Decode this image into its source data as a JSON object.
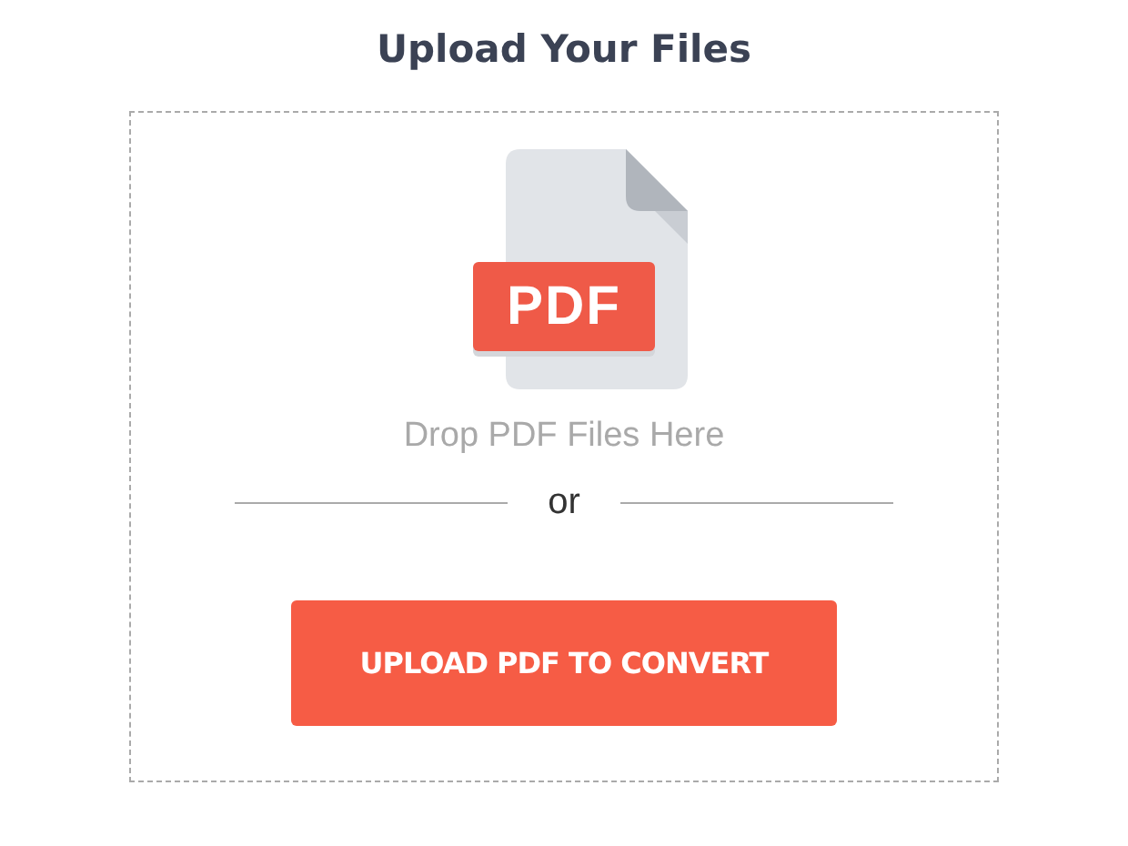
{
  "title": "Upload Your Files",
  "dropzone": {
    "icon_label": "PDF",
    "hint": "Drop PDF Files Here",
    "separator": "or",
    "button": "UPLOAD PDF TO CONVERT"
  }
}
